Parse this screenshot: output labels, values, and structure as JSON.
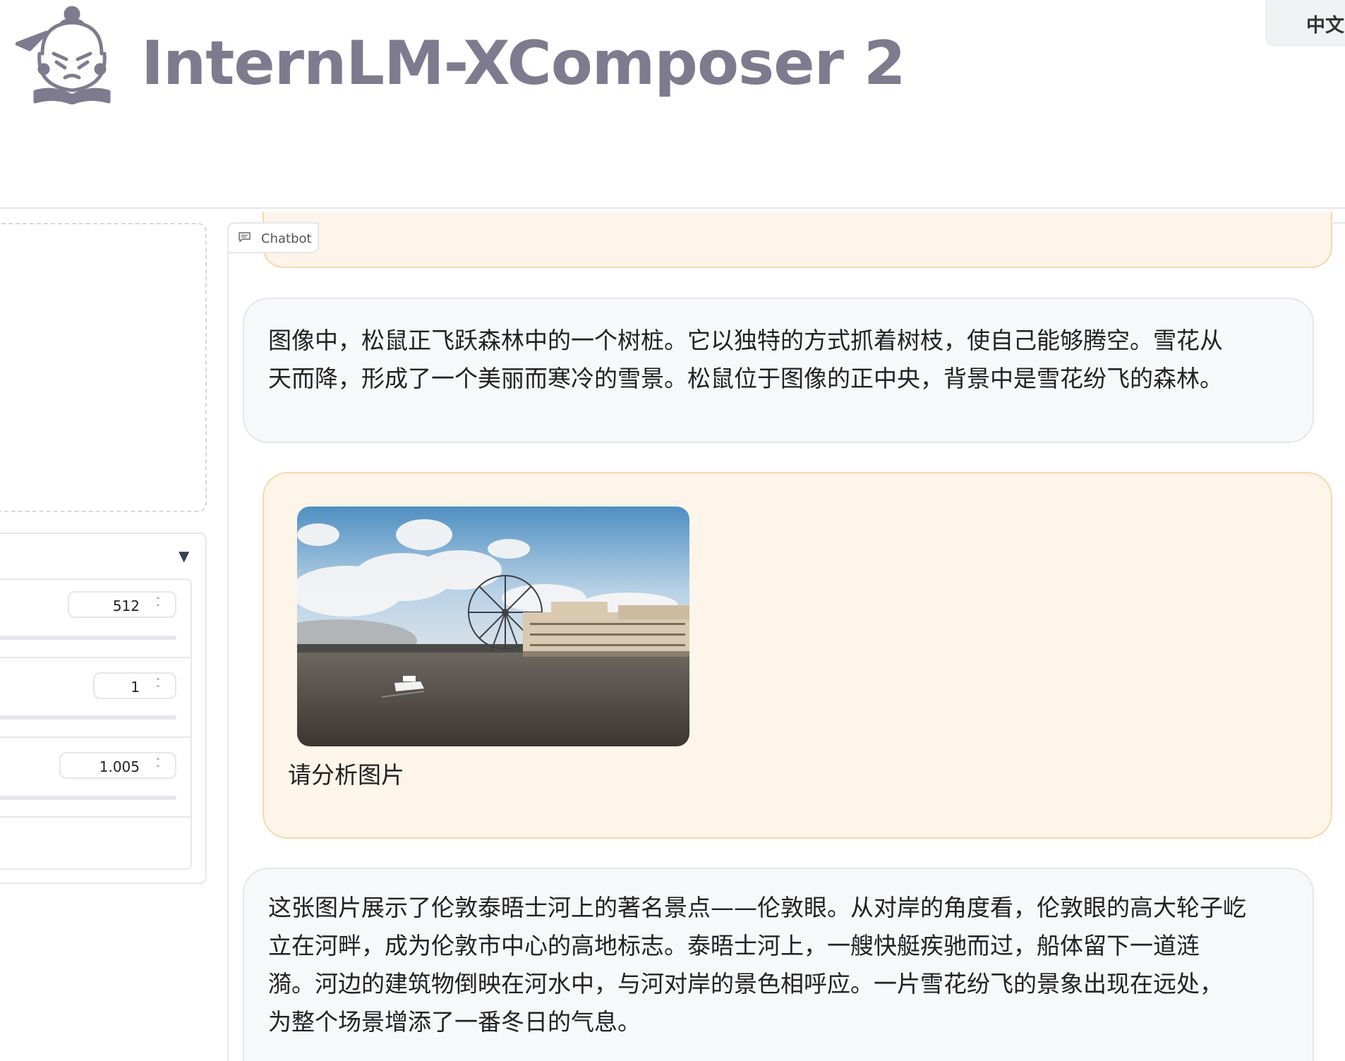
{
  "header": {
    "title": "InternLM-XComposer 2",
    "language_button": "中文"
  },
  "settings": {
    "max_tokens": "512",
    "num_beams": "1",
    "repetition_penalty": "1.005"
  },
  "chatbot": {
    "label": "Chatbot",
    "messages": [
      {
        "role": "assistant",
        "lines": [
          "图像中，松鼠正飞跃森林中的一个树桩。它以独特的方式抓着树枝，使自己能够腾空。雪花从",
          "天而降，形成了一个美丽而寒冷的雪景。松鼠位于图像的正中央，背景中是雪花纷飞的森林。"
        ]
      },
      {
        "role": "user",
        "image": "london-eye-thames-photo",
        "text": "请分析图片"
      },
      {
        "role": "assistant",
        "lines": [
          "这张图片展示了伦敦泰晤士河上的著名景点——伦敦眼。从对岸的角度看，伦敦眼的高大轮子屹",
          "立在河畔，成为伦敦市中心的高地标志。泰晤士河上，一艘快艇疾驰而过，船体留下一道涟",
          "漪。河边的建筑物倒映在河水中，与河对岸的景色相呼应。一片雪花纷飞的景象出现在远处，",
          "为整个场景增添了一番冬日的气息。"
        ]
      }
    ]
  },
  "colors": {
    "title_gray": "#7d7b8d",
    "user_bubble_bg": "#fdf4ea",
    "user_bubble_border": "#f9d7a9",
    "bot_bubble_bg": "#f7f8fa",
    "border": "#e5e7eb"
  },
  "icons": {
    "logo": "internlm-mascot-logo",
    "chatbot": "chat-bubble-icon",
    "collapse": "triangle-down-icon",
    "spinner": "up-down-chevron-icon"
  }
}
